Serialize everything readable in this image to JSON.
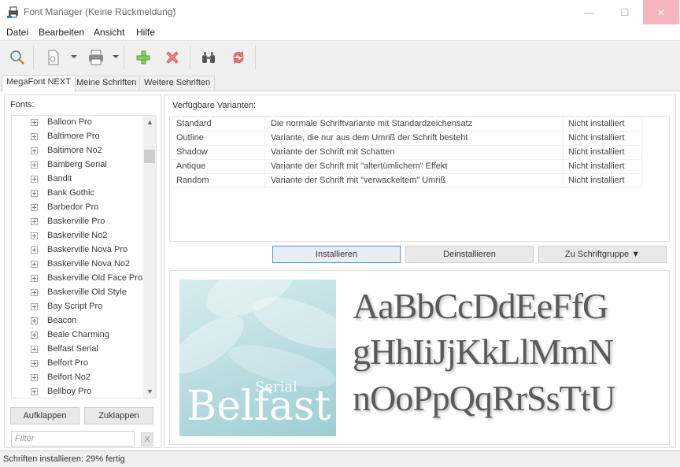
{
  "window": {
    "title": "Font Manager (Keine Rückmeldung)",
    "minimize_label": "—",
    "maximize_label": "☐",
    "close_label": "✕"
  },
  "menu": [
    "Datei",
    "Bearbeiten",
    "Ansicht",
    "Hilfe"
  ],
  "toolbar": {
    "icons": [
      "search-icon",
      "document-icon",
      "print-icon",
      "add-icon",
      "delete-icon",
      "binoculars-icon",
      "refresh-icon"
    ]
  },
  "tabs": [
    "MegaFont NEXT",
    "Meine Schriften",
    "Weitere Schriften"
  ],
  "left_panel": {
    "label": "Fonts:",
    "fonts": [
      "Balloon Pro",
      "Baltimore Pro",
      "Baltimore No2",
      "Bamberg Serial",
      "Bandit",
      "Bank Gothic",
      "Barbedor Pro",
      "Baskerville Pro",
      "Baskerville No2",
      "Baskerville Nova Pro",
      "Baskerville Nova No2",
      "Baskerville Old Face Pro",
      "Baskerville Old Style",
      "Bay Script Pro",
      "Beacon",
      "Beale Charming",
      "Belfast Serial",
      "Belfort Pro",
      "Belfort No2",
      "Bellboy Pro"
    ],
    "expand_label": "Aufklappen",
    "collapse_label": "Zuklappen",
    "filter_placeholder": "Filter",
    "filter_clear": "X"
  },
  "variants": {
    "label": "Verfügbare Varianten:",
    "rows": [
      {
        "name": "Standard",
        "desc": "Die normale Schriftvariante mit Standardzeichensatz",
        "status": "Nicht installiert"
      },
      {
        "name": "Outline",
        "desc": "Variante, die nur aus dem Umriß der Schrift besteht",
        "status": "Nicht installiert"
      },
      {
        "name": "Shadow",
        "desc": "Variante der Schrift mit Schatten",
        "status": "Nicht installiert"
      },
      {
        "name": "Antique",
        "desc": "Variante der Schrift mit \"altertümlichem\" Effekt",
        "status": "Nicht installiert"
      },
      {
        "name": "Random",
        "desc": "Variante der Schrift mit \"verwackeltem\" Umriß",
        "status": "Nicht installiert"
      }
    ],
    "install_label": "Installieren",
    "uninstall_label": "Deinstallieren",
    "group_label": "Zu Schriftgruppe ▼"
  },
  "preview": {
    "logo_main": "Belfast",
    "logo_sub": "Serial",
    "lines": [
      "AaBbCcDdEeFfG",
      "gHhIiJjKkLlMmN",
      "nOoPpQqRrSsTtU"
    ]
  },
  "status": {
    "text": "Schriften installieren: 29% fertig",
    "progress_percent": 29
  }
}
